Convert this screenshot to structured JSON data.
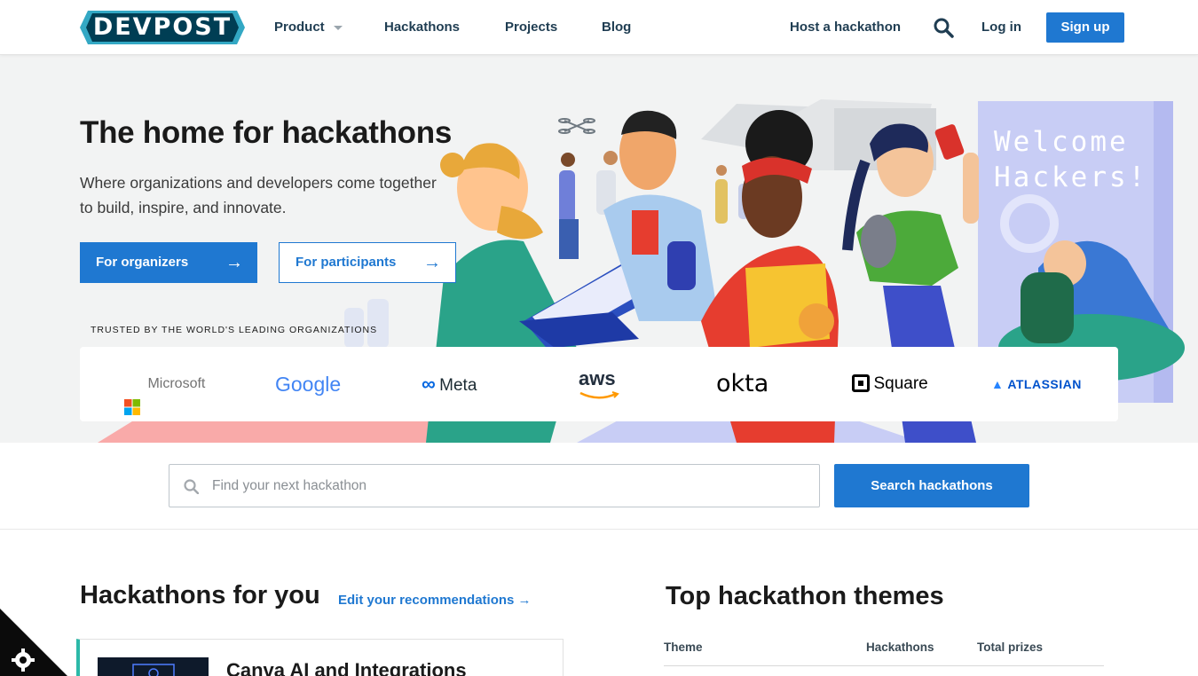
{
  "header": {
    "logo_text": "DEVPOST",
    "nav": {
      "product": "Product",
      "hackathons": "Hackathons",
      "projects": "Projects",
      "blog": "Blog",
      "host": "Host a hackathon",
      "login": "Log in",
      "signup": "Sign up"
    }
  },
  "hero": {
    "title": "The home for hackathons",
    "subtitle_line1": "Where organizations and developers come together",
    "subtitle_line2": "to build, inspire, and innovate.",
    "btn_organizers": "For organizers",
    "btn_participants": "For participants",
    "trusted": "TRUSTED BY THE WORLD'S LEADING ORGANIZATIONS",
    "banner_line1": "Welcome",
    "banner_line2": "Hackers!",
    "brands": {
      "microsoft": "Microsoft",
      "google": "Google",
      "meta": "Meta",
      "aws": "aws",
      "okta": "okta",
      "square": "Square",
      "atlassian": "ATLASSIAN"
    }
  },
  "search": {
    "placeholder": "Find your next hackathon",
    "button": "Search hackathons"
  },
  "recommendations": {
    "title": "Hackathons for you",
    "edit_link": "Edit your recommendations",
    "card_title": "Canva AI and Integrations"
  },
  "themes": {
    "title": "Top hackathon themes",
    "col_theme": "Theme",
    "col_hackathons": "Hackathons",
    "col_prizes": "Total prizes"
  },
  "colors": {
    "primary": "#1f78d1",
    "logo_dark": "#003e54",
    "logo_accent": "#33a8c4",
    "text": "#1a1a1a",
    "hero_bg": "#f2f3f3"
  }
}
